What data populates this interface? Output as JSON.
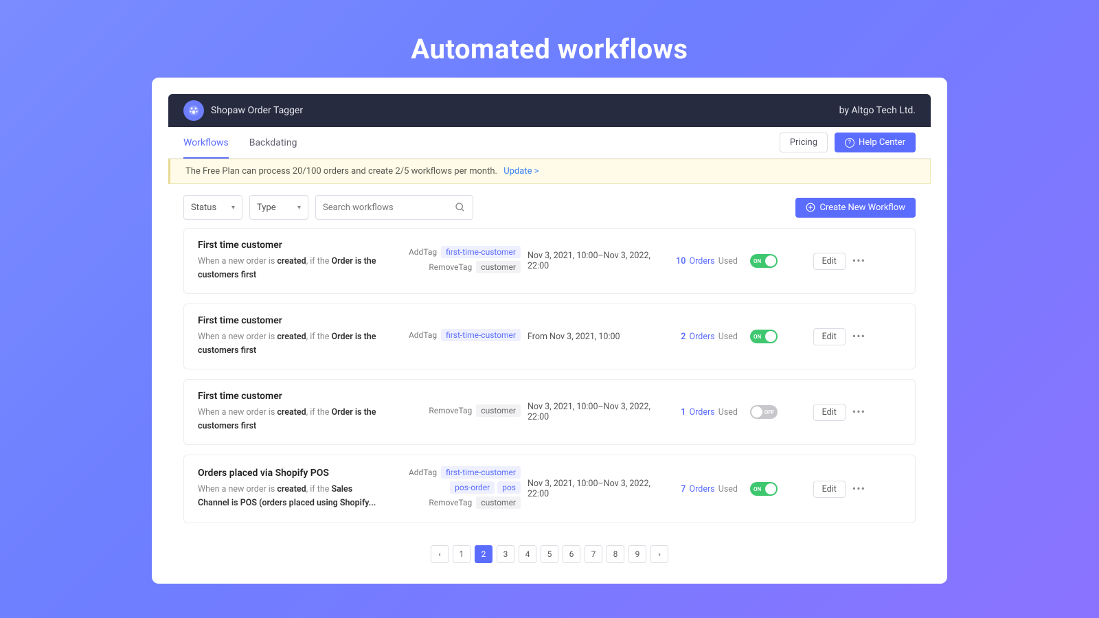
{
  "hero": {
    "title": "Automated workflows"
  },
  "header": {
    "app_name": "Shopaw Order Tagger",
    "vendor": "by Altgo Tech Ltd."
  },
  "tabs": {
    "workflows": "Workflows",
    "backdating": "Backdating"
  },
  "toolbar": {
    "pricing": "Pricing",
    "help_center": "Help Center"
  },
  "banner": {
    "text": "The Free Plan can process 20/100 orders and create 2/5 workflows per month.",
    "link": "Update >"
  },
  "filters": {
    "status_label": "Status",
    "type_label": "Type",
    "search_placeholder": "Search workflows",
    "create_button": "Create New Workflow"
  },
  "labels": {
    "add_tag": "AddTag",
    "remove_tag": "RemoveTag",
    "orders": "Orders",
    "used": "Used",
    "edit": "Edit",
    "on": "ON",
    "off": "OFF"
  },
  "workflows": [
    {
      "title": "First time customer",
      "desc_pre": "When a new order is ",
      "desc_created": "created",
      "desc_mid": ", if the ",
      "desc_cond": "Order is the customers first",
      "add_tags": [
        "first-time-customer"
      ],
      "remove_tags": [
        "customer"
      ],
      "date": "Nov 3, 2021, 10:00–Nov 3, 2022, 22:00",
      "count": "10",
      "on": true
    },
    {
      "title": "First time customer",
      "desc_pre": "When a new order is ",
      "desc_created": "created",
      "desc_mid": ", if the ",
      "desc_cond": "Order is the customers first",
      "add_tags": [
        "first-time-customer"
      ],
      "remove_tags": [],
      "date": "From Nov 3, 2021, 10:00",
      "count": "2",
      "on": true
    },
    {
      "title": "First time customer",
      "desc_pre": "When a new order is ",
      "desc_created": "created",
      "desc_mid": ", if the ",
      "desc_cond": "Order is the customers first",
      "add_tags": [],
      "remove_tags": [
        "customer"
      ],
      "date": "Nov 3, 2021, 10:00–Nov 3, 2022, 22:00",
      "count": "1",
      "on": false
    },
    {
      "title": "Orders placed via Shopify POS",
      "desc_pre": "When a new order is ",
      "desc_created": "created",
      "desc_mid": ", if the ",
      "desc_cond": "Sales Channel is POS (orders placed using Shopify...",
      "add_tags": [
        "first-time-customer",
        "pos-order",
        "pos"
      ],
      "remove_tags": [
        "customer"
      ],
      "date": "Nov 3, 2021, 10:00–Nov 3, 2022, 22:00",
      "count": "7",
      "on": true
    }
  ],
  "pagination": {
    "pages": [
      "1",
      "2",
      "3",
      "4",
      "5",
      "6",
      "7",
      "8",
      "9"
    ],
    "current": "2"
  }
}
